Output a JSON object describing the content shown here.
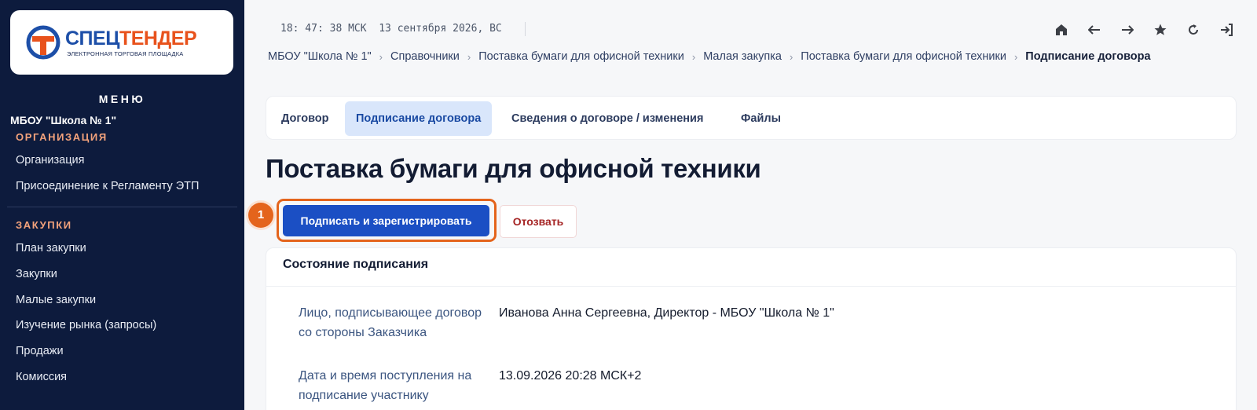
{
  "logo": {
    "part1": "СПЕЦ",
    "part2": "ТЕНДЕР",
    "subtitle": "ЭЛЕКТРОННАЯ ТОРГОВАЯ ПЛОЩАДКА"
  },
  "sidebar": {
    "menu_title": "МЕНЮ",
    "org_name": "МБОУ \"Школа № 1\"",
    "sections": [
      {
        "title": "ОРГАНИЗАЦИЯ",
        "items": [
          "Организация",
          "Присоединение к Регламенту ЭТП"
        ]
      },
      {
        "title": "ЗАКУПКИ",
        "items": [
          "План закупки",
          "Закупки",
          "Малые закупки",
          "Изучение рынка (запросы)",
          "Продажи",
          "Комиссия"
        ]
      }
    ]
  },
  "topbar": {
    "clock": "18: 47: 38 МСК  13 сентября 2026, ВС",
    "icons": [
      "home-icon",
      "back-arrow-icon",
      "forward-arrow-icon",
      "star-icon",
      "refresh-icon",
      "logout-icon"
    ]
  },
  "breadcrumb": [
    "МБОУ \"Школа № 1\"",
    "Справочники",
    "Поставка бумаги для офисной техники",
    "Малая закупка",
    "Поставка бумаги для офисной техники",
    "Подписание договора"
  ],
  "tabs": [
    {
      "label": "Договор"
    },
    {
      "label": "Подписание договора"
    },
    {
      "label": "Сведения о договоре / изменения"
    },
    {
      "label": "Файлы"
    }
  ],
  "page": {
    "title": "Поставка бумаги для офисной техники",
    "step_badge": "1",
    "sign_button": "Подписать и зарегистрировать",
    "revoke_button": "Отозвать"
  },
  "status": {
    "title": "Состояние подписания",
    "rows": [
      {
        "label": "Лицо, подписывающее договор со стороны Заказчика",
        "value": "Иванова Анна Сергеевна, Директор - МБОУ \"Школа № 1\""
      },
      {
        "label": "Дата и время поступления на подписание участнику",
        "value": "13.09.2026 20:28 МСК+2"
      }
    ]
  },
  "colors": {
    "sidebar_bg": "#0d1b3d",
    "accent": "#1b4fc4",
    "highlight": "#e4641c",
    "section_head": "#f4a37c"
  }
}
